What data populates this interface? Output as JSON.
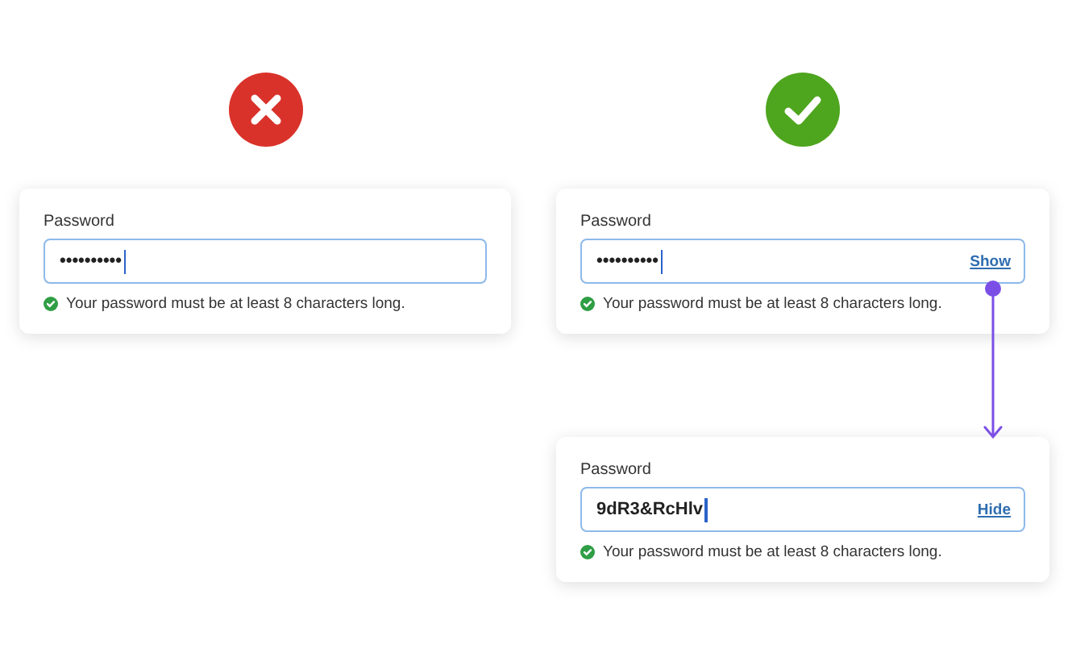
{
  "examples": [
    {
      "kind": "bad",
      "cards": [
        {
          "label": "Password",
          "value": "••••••••••",
          "hint": "Your password must be at least 8 characters long."
        }
      ]
    },
    {
      "kind": "good",
      "cards": [
        {
          "label": "Password",
          "value": "••••••••••",
          "toggle": "Show",
          "hint": "Your password must be at least 8 characters long."
        },
        {
          "label": "Password",
          "value": "9dR3&RcHlv",
          "toggle": "Hide",
          "hint": "Your password must be at least 8 characters long."
        }
      ]
    }
  ]
}
